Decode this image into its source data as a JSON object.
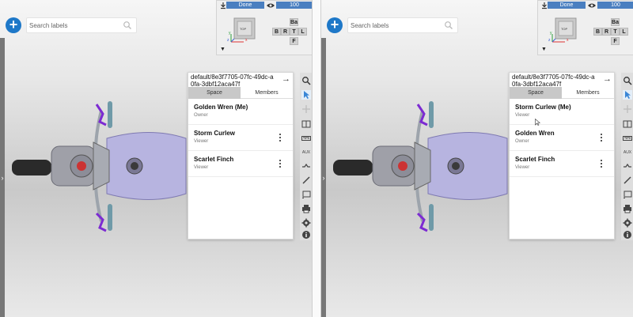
{
  "search": {
    "placeholder": "Search labels"
  },
  "view_control": {
    "status": "Done",
    "percent": "100",
    "cube_label": "TOP",
    "axes": [
      "y",
      "z",
      "x"
    ],
    "buttons": [
      "Ba",
      "B",
      "R",
      "T",
      "L",
      "F"
    ]
  },
  "toolbar": {
    "aux_label": "AUX"
  },
  "left": {
    "panel": {
      "title": "default/8e3f7705-07fc-49dc-a0fa-3dbf12aca47f",
      "tabs": [
        "Space",
        "Members"
      ],
      "members": [
        {
          "name": "Golden Wren (Me)",
          "role": "Owner"
        },
        {
          "name": "Storm Curlew",
          "role": "Viewer"
        },
        {
          "name": "Scarlet Finch",
          "role": "Viewer"
        }
      ]
    }
  },
  "right": {
    "panel": {
      "title": "default/8e3f7705-07fc-49dc-a0fa-3dbf12aca47f",
      "tabs": [
        "Space",
        "Members"
      ],
      "members": [
        {
          "name": "Storm Curlew (Me)",
          "role": "Viewer"
        },
        {
          "name": "Golden Wren",
          "role": "Owner"
        },
        {
          "name": "Scarlet Finch",
          "role": "Viewer"
        }
      ]
    }
  },
  "colors": {
    "accent": "#1e78c8",
    "status_bar": "#4a7fc0",
    "active_tool": "#3a86d6"
  }
}
